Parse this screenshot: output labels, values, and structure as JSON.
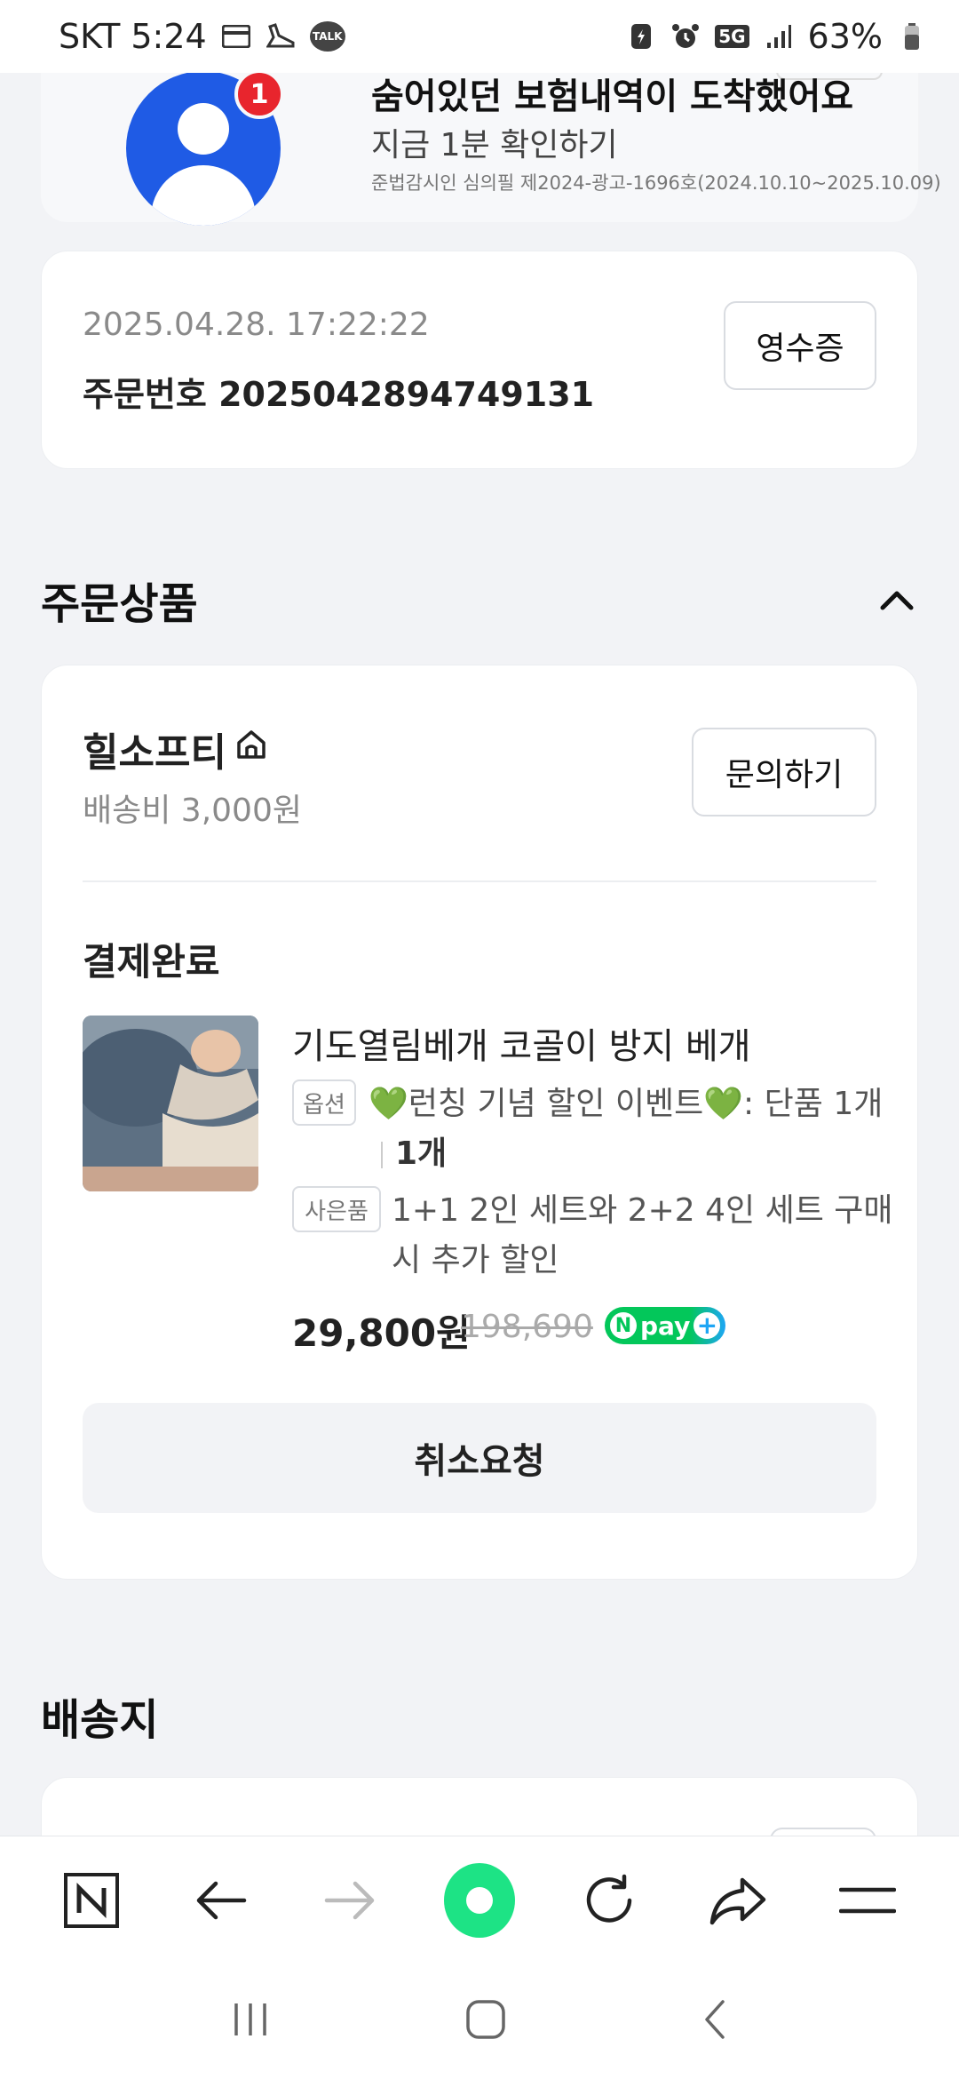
{
  "status_bar": {
    "carrier_time": "SKT 5:24",
    "network": "5G",
    "battery": "63%"
  },
  "ad": {
    "badge_count": "1",
    "title": "숨어있던 보험내역이 도착했어요",
    "subtitle": "지금 1분 확인하기",
    "legal": "준법감시인 심의필 제2024-광고-1696호(2024.10.10~2025.10.09)"
  },
  "order": {
    "datetime": "2025.04.28. 17:22:22",
    "number": "주문번호 2025042894749131",
    "receipt_label": "영수증"
  },
  "section_products": {
    "title": "주문상품"
  },
  "seller": {
    "name": "힐소프티",
    "shipping_fee": "배송비 3,000원",
    "inquiry_label": "문의하기"
  },
  "item": {
    "status": "결제완료",
    "name": "기도열림베개 코골이 방지 베개",
    "option_tag": "옵션",
    "option_text": "💚런칭 기념 할인 이벤트💚: 단품 1개",
    "quantity": "1개",
    "gift_tag": "사은품",
    "gift_text": "1+1 2인 세트와 2+2 4인 세트 구매 시 추가 할인",
    "price": "29,800원",
    "original_price": "198,690",
    "npay_label": "pay"
  },
  "cancel_label": "취소요청",
  "section_shipping": {
    "title": "배송지"
  },
  "browser_bar": {
    "icons": [
      "naver-icon",
      "back-arrow-icon",
      "forward-arrow-icon",
      "home-icon",
      "refresh-icon",
      "share-icon",
      "menu-icon"
    ]
  },
  "system_nav": {
    "icons": [
      "recent-apps-icon",
      "home-nav-icon",
      "back-nav-icon"
    ]
  },
  "colors": {
    "accent_green": "#03c75a",
    "ad_blue": "#1f5be5",
    "badge_red": "#e8252d"
  }
}
